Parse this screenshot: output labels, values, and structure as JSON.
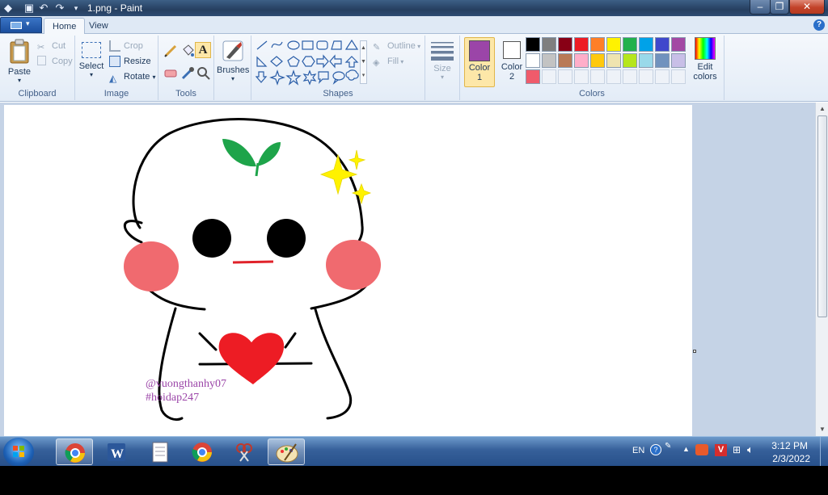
{
  "window": {
    "title": "1.png - Paint",
    "file_menu": "▾"
  },
  "tabs": [
    {
      "label": "Home"
    },
    {
      "label": "View"
    }
  ],
  "clipboard": {
    "paste": "Paste",
    "cut": "Cut",
    "copy": "Copy",
    "group": "Clipboard"
  },
  "image": {
    "select": "Select",
    "crop": "Crop",
    "resize": "Resize",
    "rotate": "Rotate",
    "group": "Image"
  },
  "tools": {
    "group": "Tools"
  },
  "brushes": {
    "label": "Brushes"
  },
  "shapes": {
    "outline": "Outline",
    "fill": "Fill",
    "group": "Shapes"
  },
  "size": {
    "label": "Size"
  },
  "colors": {
    "color1_label": "Color",
    "color1_num": "1",
    "color2_label": "Color",
    "color2_num": "2",
    "edit": "Edit colors",
    "group": "Colors",
    "color1": "#9b45a8",
    "color2": "#ffffff",
    "palette": [
      "#000000",
      "#7f7f7f",
      "#880015",
      "#ed1c24",
      "#ff7f27",
      "#fff200",
      "#22b14c",
      "#00a2e8",
      "#3f48cc",
      "#a349a4",
      "#ffffff",
      "#c3c3c3",
      "#b97a57",
      "#ffaec9",
      "#ffc90e",
      "#efe4b0",
      "#b5e61d",
      "#99d9ea",
      "#7092be",
      "#c8bfe7",
      "#ef5b6b"
    ]
  },
  "canvas": {
    "watermark_line1": "@vuongthanhy07",
    "watermark_line2": "#hoidap247",
    "drawing": "white blob character with leaf, sparkles, pink cheeks and red heart"
  },
  "taskbar": {
    "apps": [
      "chrome-icon",
      "word-icon",
      "notepad-icon",
      "chrome-icon",
      "snipping-tool-icon",
      "paint-icon"
    ],
    "lang": "EN",
    "time": "3:12 PM",
    "date": "2/3/2022"
  }
}
